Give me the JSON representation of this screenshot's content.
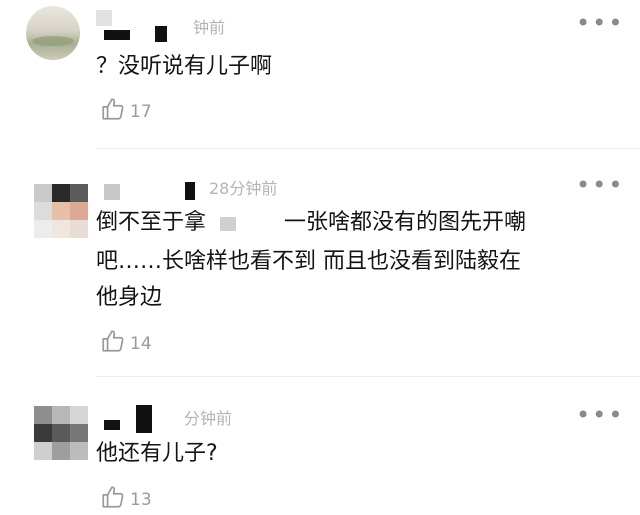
{
  "comments": [
    {
      "time": "钟前",
      "content": "？没听说有儿子啊",
      "likes": "17"
    },
    {
      "time": "28分钟前",
      "content_line1": "倒不至于拿",
      "content_line1b": "一张啥都没有的图先开嘲",
      "content_rest": "吧……长啥样也看不到 而且也没看到陆毅在\n他身边",
      "likes": "14"
    },
    {
      "time": "分钟前",
      "content": "他还有儿子?",
      "likes": "13"
    }
  ],
  "icons": {
    "like": "thumbs-up-icon",
    "more": "more-dots-icon"
  },
  "colors": {
    "text": "#141414",
    "meta": "#b4b4b4",
    "like": "#9a9a9a"
  }
}
